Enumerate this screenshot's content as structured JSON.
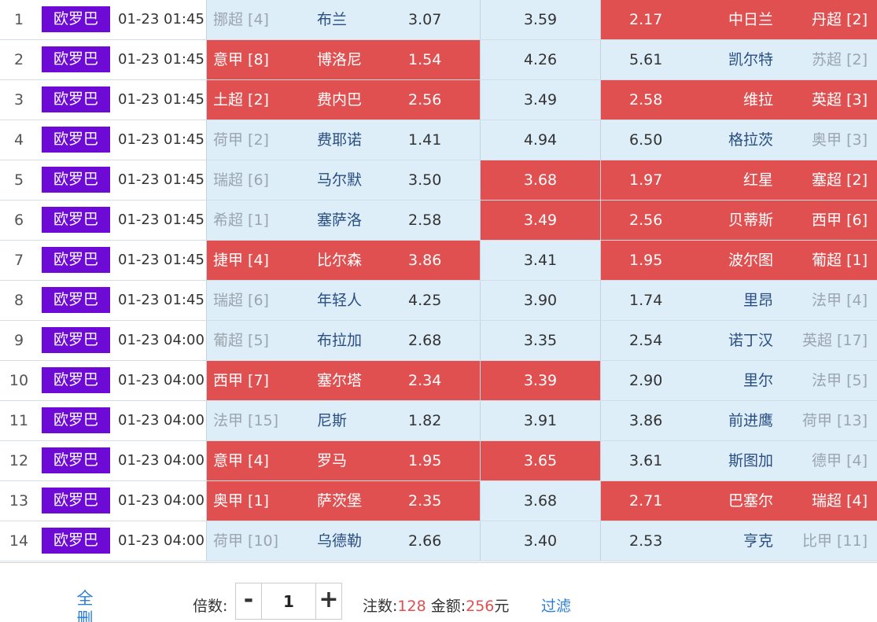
{
  "matches": [
    {
      "idx": "1",
      "badge": "欧罗巴",
      "time": "01-23 01:45",
      "home_league": "挪超 [4]",
      "home_team": "布兰",
      "home_odds": "3.07",
      "draw_odds": "3.59",
      "away_odds": "2.17",
      "away_team": "中日兰",
      "away_league": "丹超 [2]",
      "hot": {
        "home": false,
        "draw": false,
        "away": true
      }
    },
    {
      "idx": "2",
      "badge": "欧罗巴",
      "time": "01-23 01:45",
      "home_league": "意甲 [8]",
      "home_team": "博洛尼",
      "home_odds": "1.54",
      "draw_odds": "4.26",
      "away_odds": "5.61",
      "away_team": "凯尔特",
      "away_league": "苏超 [2]",
      "hot": {
        "home": true,
        "draw": false,
        "away": false
      }
    },
    {
      "idx": "3",
      "badge": "欧罗巴",
      "time": "01-23 01:45",
      "home_league": "土超 [2]",
      "home_team": "费内巴",
      "home_odds": "2.56",
      "draw_odds": "3.49",
      "away_odds": "2.58",
      "away_team": "维拉",
      "away_league": "英超 [3]",
      "hot": {
        "home": true,
        "draw": false,
        "away": true
      }
    },
    {
      "idx": "4",
      "badge": "欧罗巴",
      "time": "01-23 01:45",
      "home_league": "荷甲 [2]",
      "home_team": "费耶诺",
      "home_odds": "1.41",
      "draw_odds": "4.94",
      "away_odds": "6.50",
      "away_team": "格拉茨",
      "away_league": "奥甲 [3]",
      "hot": {
        "home": false,
        "draw": false,
        "away": false
      }
    },
    {
      "idx": "5",
      "badge": "欧罗巴",
      "time": "01-23 01:45",
      "home_league": "瑞超 [6]",
      "home_team": "马尔默",
      "home_odds": "3.50",
      "draw_odds": "3.68",
      "away_odds": "1.97",
      "away_team": "红星",
      "away_league": "塞超 [2]",
      "hot": {
        "home": false,
        "draw": true,
        "away": true
      }
    },
    {
      "idx": "6",
      "badge": "欧罗巴",
      "time": "01-23 01:45",
      "home_league": "希超 [1]",
      "home_team": "塞萨洛",
      "home_odds": "2.58",
      "draw_odds": "3.49",
      "away_odds": "2.56",
      "away_team": "贝蒂斯",
      "away_league": "西甲 [6]",
      "hot": {
        "home": false,
        "draw": true,
        "away": true
      }
    },
    {
      "idx": "7",
      "badge": "欧罗巴",
      "time": "01-23 01:45",
      "home_league": "捷甲 [4]",
      "home_team": "比尔森",
      "home_odds": "3.86",
      "draw_odds": "3.41",
      "away_odds": "1.95",
      "away_team": "波尔图",
      "away_league": "葡超 [1]",
      "hot": {
        "home": true,
        "draw": false,
        "away": true
      }
    },
    {
      "idx": "8",
      "badge": "欧罗巴",
      "time": "01-23 01:45",
      "home_league": "瑞超 [6]",
      "home_team": "年轻人",
      "home_odds": "4.25",
      "draw_odds": "3.90",
      "away_odds": "1.74",
      "away_team": "里昂",
      "away_league": "法甲 [4]",
      "hot": {
        "home": false,
        "draw": false,
        "away": false
      }
    },
    {
      "idx": "9",
      "badge": "欧罗巴",
      "time": "01-23 04:00",
      "home_league": "葡超 [5]",
      "home_team": "布拉加",
      "home_odds": "2.68",
      "draw_odds": "3.35",
      "away_odds": "2.54",
      "away_team": "诺丁汉",
      "away_league": "英超 [17]",
      "hot": {
        "home": false,
        "draw": false,
        "away": false
      }
    },
    {
      "idx": "10",
      "badge": "欧罗巴",
      "time": "01-23 04:00",
      "home_league": "西甲 [7]",
      "home_team": "塞尔塔",
      "home_odds": "2.34",
      "draw_odds": "3.39",
      "away_odds": "2.90",
      "away_team": "里尔",
      "away_league": "法甲 [5]",
      "hot": {
        "home": true,
        "draw": true,
        "away": false
      }
    },
    {
      "idx": "11",
      "badge": "欧罗巴",
      "time": "01-23 04:00",
      "home_league": "法甲 [15]",
      "home_team": "尼斯",
      "home_odds": "1.82",
      "draw_odds": "3.91",
      "away_odds": "3.86",
      "away_team": "前进鹰",
      "away_league": "荷甲 [13]",
      "hot": {
        "home": false,
        "draw": false,
        "away": false
      }
    },
    {
      "idx": "12",
      "badge": "欧罗巴",
      "time": "01-23 04:00",
      "home_league": "意甲 [4]",
      "home_team": "罗马",
      "home_odds": "1.95",
      "draw_odds": "3.65",
      "away_odds": "3.61",
      "away_team": "斯图加",
      "away_league": "德甲 [4]",
      "hot": {
        "home": true,
        "draw": true,
        "away": false
      }
    },
    {
      "idx": "13",
      "badge": "欧罗巴",
      "time": "01-23 04:00",
      "home_league": "奥甲 [1]",
      "home_team": "萨茨堡",
      "home_odds": "2.35",
      "draw_odds": "3.68",
      "away_odds": "2.71",
      "away_team": "巴塞尔",
      "away_league": "瑞超 [4]",
      "hot": {
        "home": true,
        "draw": false,
        "away": true
      }
    },
    {
      "idx": "14",
      "badge": "欧罗巴",
      "time": "01-23 04:00",
      "home_league": "荷甲 [10]",
      "home_team": "乌德勒",
      "home_odds": "2.66",
      "draw_odds": "3.40",
      "away_odds": "2.53",
      "away_team": "亨克",
      "away_league": "比甲 [11]",
      "hot": {
        "home": false,
        "draw": false,
        "away": false
      }
    }
  ],
  "footer": {
    "delete_all": "全删",
    "multiplier_label": "倍数:",
    "minus": "-",
    "multiplier_value": "1",
    "plus": "+",
    "bets_label": "注数:",
    "bets_value": "128",
    "amount_label": "金额:",
    "amount_value": "256",
    "amount_unit": "元",
    "filter": "过滤"
  },
  "colors": {
    "hot": "#e05050",
    "odds_bg": "#ddeef9",
    "badge": "#6e0ad6",
    "link": "#2b7ed6"
  }
}
